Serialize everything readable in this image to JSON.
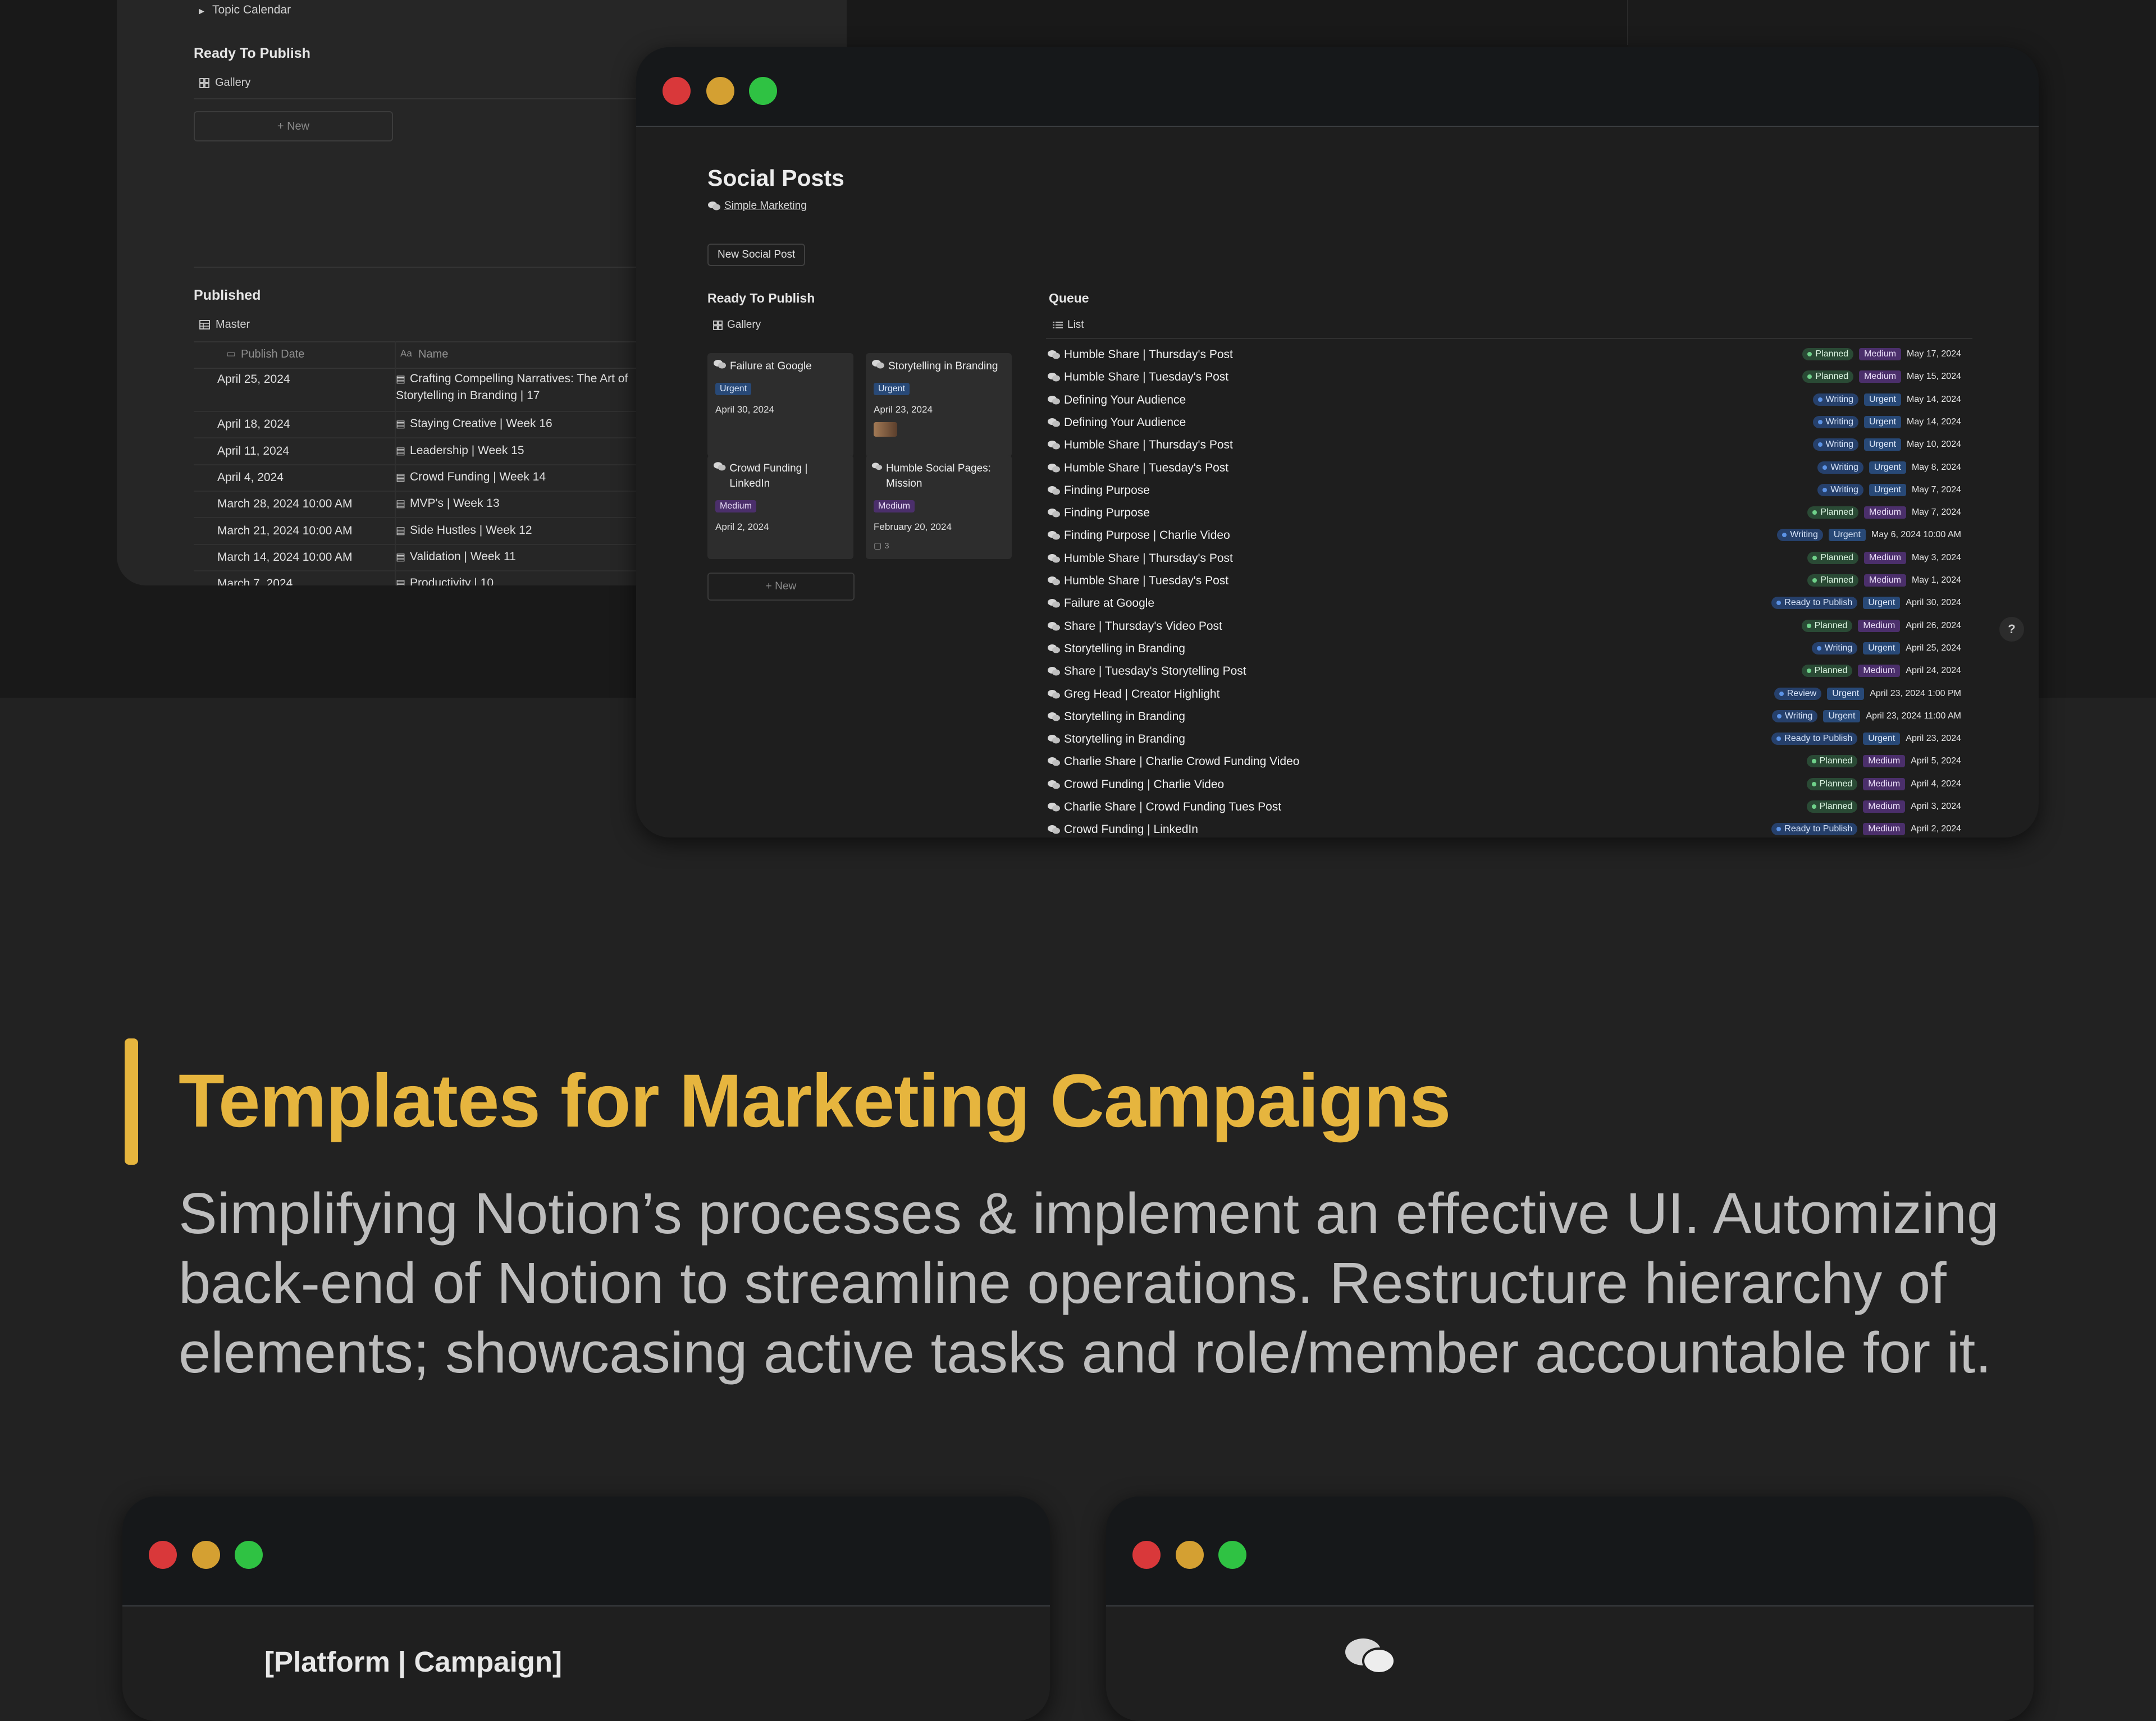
{
  "background_window": {
    "toggle_label": "Topic Calendar",
    "ready_section": "Ready To Publish",
    "gallery_view": "Gallery",
    "new_label": "+ New",
    "published_section": "Published",
    "master_view": "Master",
    "columns": [
      "Publish Date",
      "Name"
    ],
    "rows": [
      {
        "date": "April 25, 2024",
        "name": "Crafting Compelling Narratives: The Art of Storytelling in Branding | 17"
      },
      {
        "date": "April 18, 2024",
        "name": "Staying Creative | Week 16"
      },
      {
        "date": "April 11, 2024",
        "name": "Leadership | Week 15"
      },
      {
        "date": "April 4, 2024",
        "name": "Crowd Funding | Week 14"
      },
      {
        "date": "March 28, 2024 10:00 AM",
        "name": "MVP's | Week 13"
      },
      {
        "date": "March 21, 2024 10:00 AM",
        "name": "Side Hustles | Week 12"
      },
      {
        "date": "March 14, 2024 10:00 AM",
        "name": "Validation | Week 11"
      },
      {
        "date": "March 7, 2024",
        "name": "Productivity | 10"
      }
    ]
  },
  "front_window": {
    "title": "Social Posts",
    "breadcrumb": "Simple Marketing",
    "new_button": "New Social Post",
    "ready_section": "Ready To Publish",
    "gallery_view": "Gallery",
    "queue_section": "Queue",
    "list_view": "List",
    "new_card_label": "+ New",
    "comment_count": "3",
    "help_label": "?",
    "cards": [
      {
        "title": "Failure at Google",
        "priority": "Urgent",
        "date": "April 30, 2024"
      },
      {
        "title": "Storytelling in Branding",
        "priority": "Urgent",
        "date": "April 23, 2024"
      },
      {
        "title": "Crowd Funding | LinkedIn",
        "priority": "Medium",
        "date": "April 2, 2024"
      },
      {
        "title": "Humble Social Pages: Mission",
        "priority": "Medium",
        "date": "February 20, 2024"
      }
    ],
    "queue": [
      {
        "name": "Humble Share | Thursday's Post",
        "status": "Planned",
        "priority": "Medium",
        "date": "May 17, 2024"
      },
      {
        "name": "Humble Share | Tuesday's Post",
        "status": "Planned",
        "priority": "Medium",
        "date": "May 15, 2024"
      },
      {
        "name": "Defining Your Audience",
        "status": "Writing",
        "priority": "Urgent",
        "date": "May 14, 2024"
      },
      {
        "name": "Defining Your Audience",
        "status": "Writing",
        "priority": "Urgent",
        "date": "May 14, 2024"
      },
      {
        "name": "Humble Share | Thursday's Post",
        "status": "Writing",
        "priority": "Urgent",
        "date": "May 10, 2024"
      },
      {
        "name": "Humble Share | Tuesday's Post",
        "status": "Writing",
        "priority": "Urgent",
        "date": "May 8, 2024"
      },
      {
        "name": "Finding Purpose",
        "status": "Writing",
        "priority": "Urgent",
        "date": "May 7, 2024"
      },
      {
        "name": "Finding Purpose",
        "status": "Planned",
        "priority": "Medium",
        "date": "May 7, 2024"
      },
      {
        "name": "Finding Purpose | Charlie Video",
        "status": "Writing",
        "priority": "Urgent",
        "date": "May 6, 2024 10:00 AM"
      },
      {
        "name": "Humble Share | Thursday's Post",
        "status": "Planned",
        "priority": "Medium",
        "date": "May 3, 2024"
      },
      {
        "name": "Humble Share | Tuesday's Post",
        "status": "Planned",
        "priority": "Medium",
        "date": "May 1, 2024"
      },
      {
        "name": "Failure at Google",
        "status": "Ready to Publish",
        "priority": "Urgent",
        "date": "April 30, 2024"
      },
      {
        "name": "Share | Thursday's Video Post",
        "status": "Planned",
        "priority": "Medium",
        "date": "April 26, 2024"
      },
      {
        "name": "Storytelling in Branding",
        "status": "Writing",
        "priority": "Urgent",
        "date": "April 25, 2024"
      },
      {
        "name": "Share | Tuesday's Storytelling Post",
        "status": "Planned",
        "priority": "Medium",
        "date": "April 24, 2024"
      },
      {
        "name": "Greg Head | Creator Highlight",
        "status": "Review",
        "priority": "Urgent",
        "date": "April 23, 2024 1:00 PM"
      },
      {
        "name": "Storytelling in Branding",
        "status": "Writing",
        "priority": "Urgent",
        "date": "April 23, 2024 11:00 AM"
      },
      {
        "name": "Storytelling in Branding",
        "status": "Ready to Publish",
        "priority": "Urgent",
        "date": "April 23, 2024"
      },
      {
        "name": "Charlie Share | Charlie Crowd Funding Video",
        "status": "Planned",
        "priority": "Medium",
        "date": "April 5, 2024"
      },
      {
        "name": "Crowd Funding | Charlie Video",
        "status": "Planned",
        "priority": "Medium",
        "date": "April 4, 2024"
      },
      {
        "name": "Charlie Share | Crowd Funding Tues Post",
        "status": "Planned",
        "priority": "Medium",
        "date": "April 3, 2024"
      },
      {
        "name": "Crowd Funding | LinkedIn",
        "status": "Ready to Publish",
        "priority": "Medium",
        "date": "April 2, 2024"
      }
    ]
  },
  "section": {
    "heading": "Templates for Marketing Campaigns",
    "description": "Simplifying Notion’s processes & implement an effective UI. Automizing back-end of Notion to streamline operations. Restructure hierarchy of elements; showcasing active tasks and role/member accountable for it."
  },
  "bottom_windows": {
    "left_title": "[Platform | Campaign]"
  },
  "colors": {
    "accent": "#e6b53e",
    "traffic_red": "#d9383a",
    "traffic_yellow": "#d4a032",
    "traffic_green": "#2fc243",
    "planned": "#2a4a35",
    "writing": "#26406b",
    "ready": "#26406b",
    "review": "#26406b",
    "urgent": "#284977",
    "medium": "#4b2f6b"
  }
}
